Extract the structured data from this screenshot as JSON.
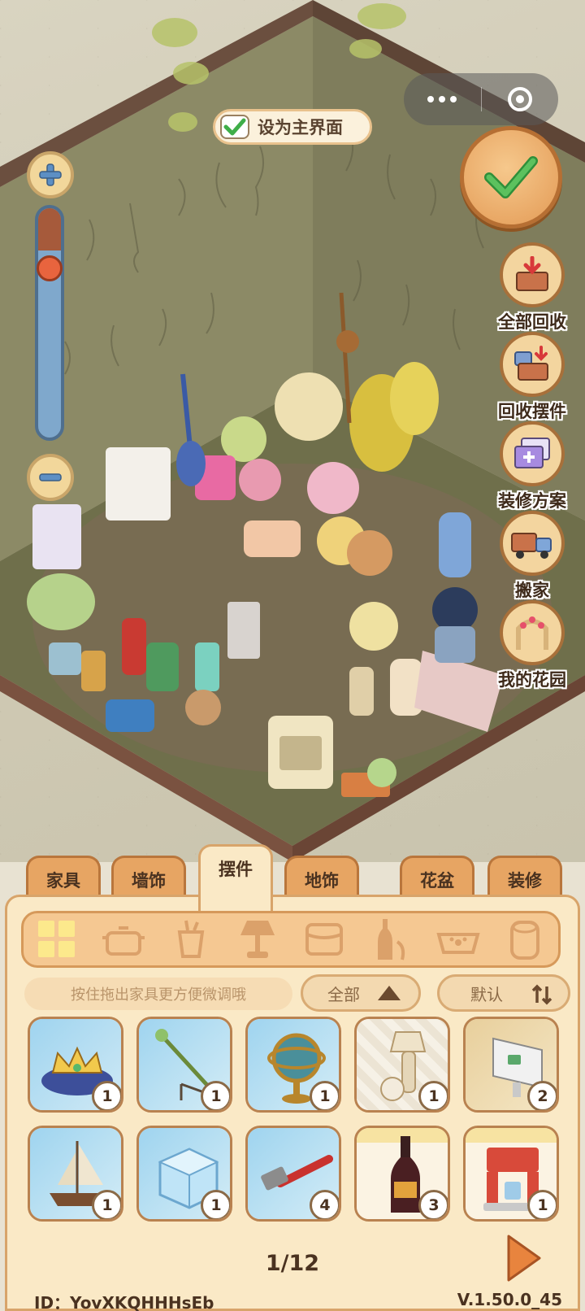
{
  "top": {
    "set_main_label": "设为主界面"
  },
  "zoom": {
    "level": 0.15
  },
  "side_buttons": [
    {
      "label": "全部回收",
      "icon": "recycle-all-box-icon"
    },
    {
      "label": "回收摆件",
      "icon": "recycle-ornament-icon"
    },
    {
      "label": "装修方案",
      "icon": "decoration-plan-icon"
    },
    {
      "label": "搬家",
      "icon": "moving-truck-icon"
    },
    {
      "label": "我的花园",
      "icon": "garden-arch-icon"
    }
  ],
  "tabs": [
    {
      "label": "家具",
      "active": false
    },
    {
      "label": "墙饰",
      "active": false
    },
    {
      "label": "摆件",
      "active": true
    },
    {
      "label": "地饰",
      "active": false
    },
    {
      "label": "花盆",
      "active": false
    },
    {
      "label": "装修",
      "active": false
    }
  ],
  "categories": [
    "all-grid-icon",
    "pot-icon",
    "cup-icon",
    "lamp-icon",
    "cushion-icon",
    "bottle-icon",
    "pet-bowl-icon",
    "tissue-roll-icon"
  ],
  "hint": "按住拖出家具更方便微调哦",
  "filter": {
    "label": "全部"
  },
  "sort": {
    "label": "默认"
  },
  "items": [
    {
      "name": "crown-cushion",
      "count": "1"
    },
    {
      "name": "staff-on-stand",
      "count": "1"
    },
    {
      "name": "armillary-globe",
      "count": "1"
    },
    {
      "name": "table-lamp-vase",
      "count": "1"
    },
    {
      "name": "computer-monitor",
      "count": "2"
    },
    {
      "name": "sailboat-model",
      "count": "1"
    },
    {
      "name": "ice-cube-block",
      "count": "1"
    },
    {
      "name": "red-hammer",
      "count": "4"
    },
    {
      "name": "wine-bottle",
      "count": "3"
    },
    {
      "name": "coffee-machine",
      "count": "1"
    }
  ],
  "pagination": "1/12",
  "footer": {
    "id": "ID：YovXKQHHHsEb",
    "version": "V.1.50.0_45"
  },
  "colors": {
    "tab": "#e7a563",
    "panel": "#fae9c6",
    "accent_green": "#3fae49",
    "text_dark": "#4a3220"
  }
}
